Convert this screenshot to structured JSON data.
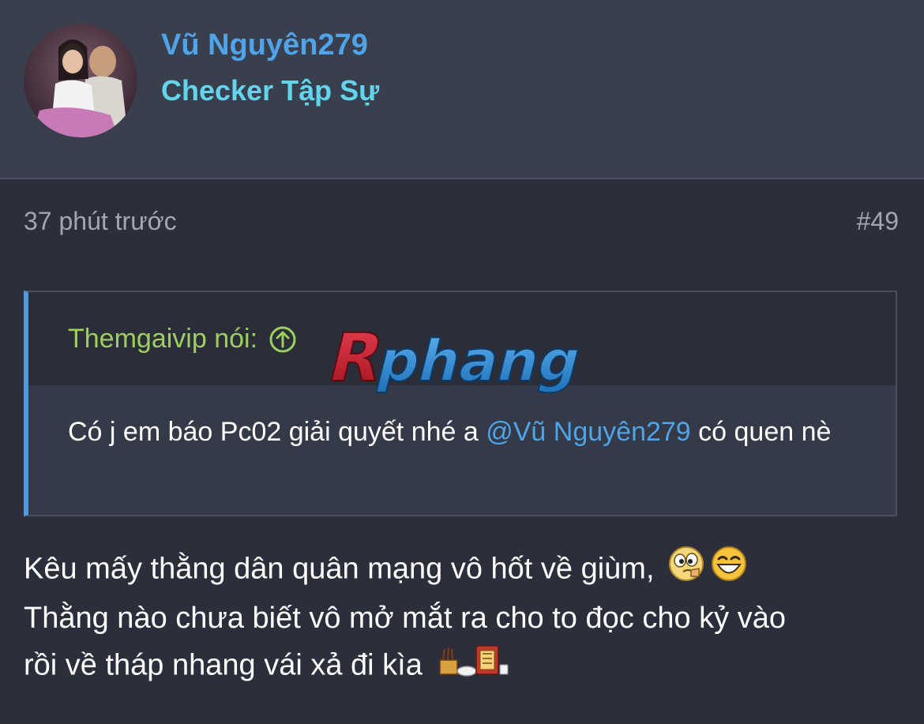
{
  "user": {
    "name": "Vũ Nguyên279",
    "title": "Checker Tập Sự"
  },
  "post": {
    "time": "37 phút trước",
    "number": "#49"
  },
  "quote": {
    "author_label": "Themgaivip nói:",
    "text_before": "Có j em báo Pc02 giải quyết nhé a ",
    "mention": "@Vũ Nguyên279",
    "text_after": " có quen nè"
  },
  "watermark": {
    "text": "Rphang"
  },
  "message": {
    "line1": "Kêu mấy thằng dân quân mạng vô hốt về giùm,",
    "line2": "Thằng nào chưa biết vô mở mắt ra cho to đọc cho kỷ vào",
    "line3": "rồi về tháp nhang vái xả đi kìa"
  },
  "colors": {
    "background": "#2c2f3b",
    "header_bg": "#3a3f4d",
    "username": "#4fa3e8",
    "user_title": "#63d4ec",
    "quote_author": "#9ccf5e",
    "quote_accent": "#4f9be0",
    "mention": "#4fa3e8"
  },
  "icons": [
    "avatar-photo",
    "arrow-up-circle-icon",
    "thinking-emoji-icon",
    "laughing-emoji-icon",
    "incense-altar-emoji-icon"
  ]
}
